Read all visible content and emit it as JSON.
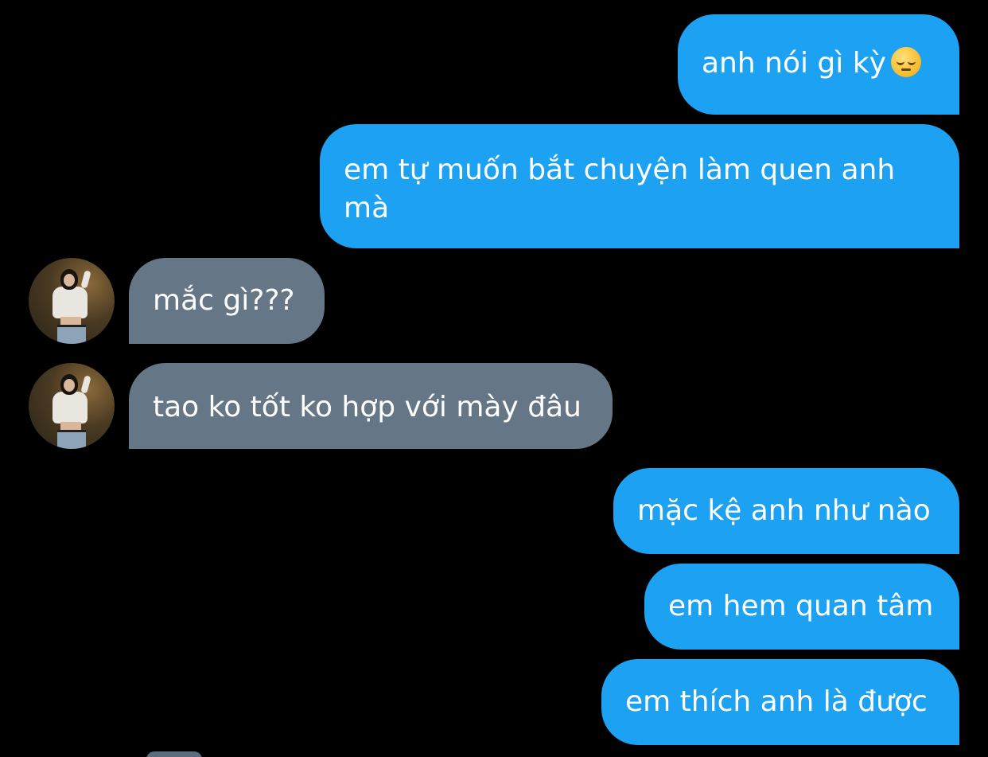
{
  "messages": [
    {
      "id": 1,
      "direction": "sent",
      "text": "anh nói gì kỳ",
      "emoji": "pensive-face"
    },
    {
      "id": 2,
      "direction": "sent",
      "text": "em tự muốn bắt chuyện làm quen anh mà"
    },
    {
      "id": 3,
      "direction": "received",
      "text": "mắc gì???"
    },
    {
      "id": 4,
      "direction": "received",
      "text": "tao ko tốt ko hợp với mày đâu"
    },
    {
      "id": 5,
      "direction": "sent",
      "text": "mặc kệ anh như nào"
    },
    {
      "id": 6,
      "direction": "sent",
      "text": "em hem quan tâm"
    },
    {
      "id": 7,
      "direction": "sent",
      "text": "em thích anh là được"
    }
  ],
  "colors": {
    "background": "#000000",
    "sent_bubble": "#1da1f2",
    "received_bubble": "#657786",
    "text": "#ffffff"
  }
}
